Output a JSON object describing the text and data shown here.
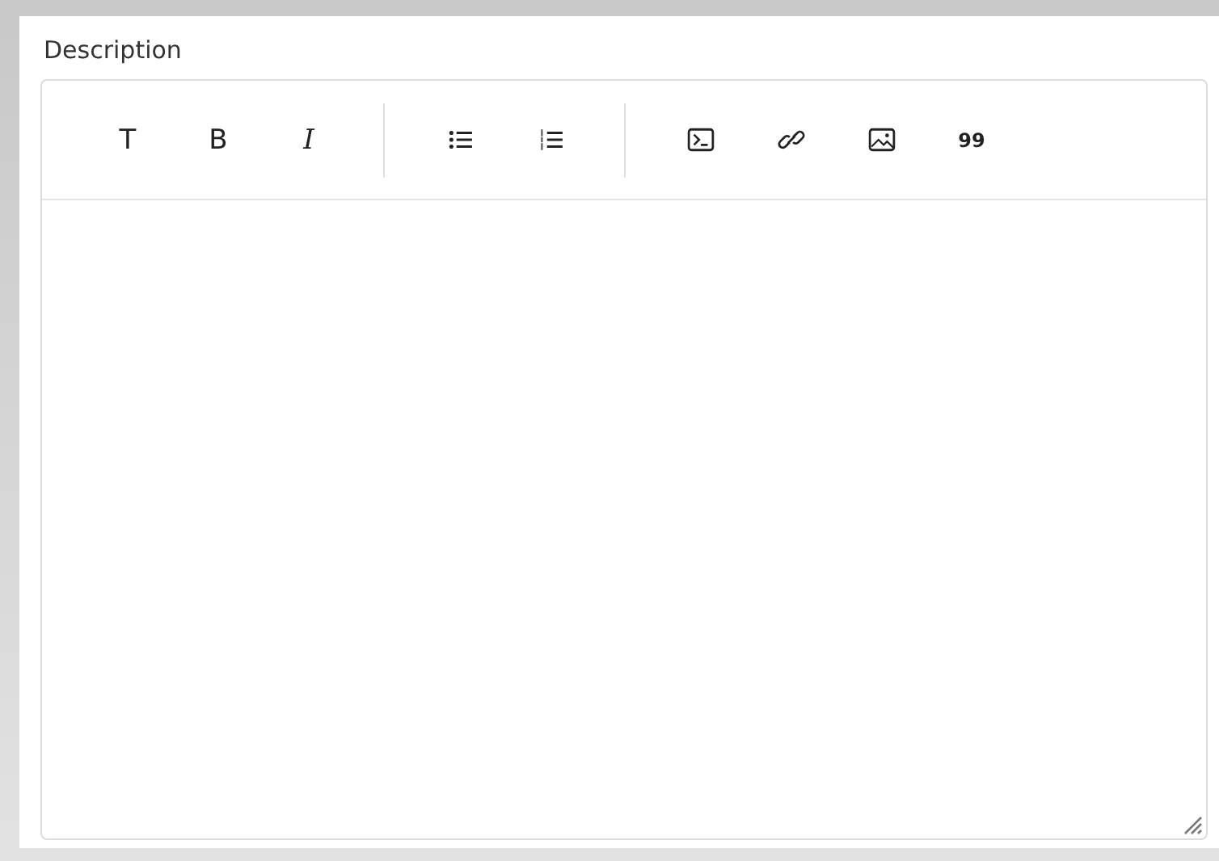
{
  "field": {
    "label": "Description"
  },
  "toolbar": [
    [
      {
        "kind": "glyph",
        "text": "T"
      },
      {
        "kind": "glyph",
        "text": "B"
      },
      {
        "kind": "italic",
        "text": "I"
      }
    ],
    [
      {
        "kind": "bullet-list"
      },
      {
        "kind": "numbered-list"
      }
    ],
    [
      {
        "kind": "code"
      },
      {
        "kind": "link"
      },
      {
        "kind": "image"
      },
      {
        "kind": "quote",
        "text": "99"
      }
    ]
  ]
}
